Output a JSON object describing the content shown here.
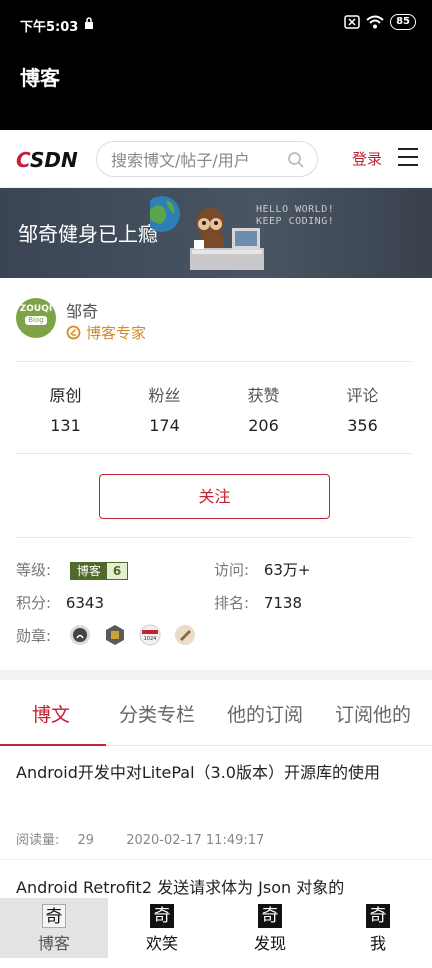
{
  "status_bar": {
    "time": "下午5:03",
    "battery": "85"
  },
  "app_bar": {
    "title": "博客"
  },
  "header": {
    "logo_c": "C",
    "logo_rest": "SDN",
    "search_placeholder": "搜索博文/帖子/用户",
    "login_label": "登录"
  },
  "banner": {
    "title": "邹奇健身已上瘾",
    "hello_line1": "HELLO WORLD!",
    "hello_line2": "KEEP CODING!"
  },
  "profile": {
    "avatar_text": "ZOUQI",
    "avatar_sub": "Blog",
    "username": "邹奇",
    "expert_label": "博客专家",
    "stats": [
      {
        "label": "原创",
        "value": "131"
      },
      {
        "label": "粉丝",
        "value": "174"
      },
      {
        "label": "获赞",
        "value": "206"
      },
      {
        "label": "评论",
        "value": "356"
      }
    ],
    "follow_label": "关注",
    "level_label": "等级:",
    "level_badge_text": "博客",
    "level_badge_num": "6",
    "visits_label": "访问:",
    "visits_value": "63万+",
    "points_label": "积分:",
    "points_value": "6343",
    "rank_label": "排名:",
    "rank_value": "7138",
    "medals_label": "勋章:",
    "medal_1024": "1024"
  },
  "tabs": [
    {
      "label": "博文",
      "active": true
    },
    {
      "label": "分类专栏",
      "active": false
    },
    {
      "label": "他的订阅",
      "active": false
    },
    {
      "label": "订阅他的",
      "active": false
    }
  ],
  "articles": [
    {
      "title": "Android开发中对LitePal（3.0版本）开源库的使用",
      "reads_label": "阅读量:",
      "reads": "29",
      "date": "2020-02-17 11:49:17"
    },
    {
      "title": "Android Retrofit2 发送请求体为 Json 对象的"
    }
  ],
  "bottom_nav": [
    {
      "icon": "奇",
      "label": "博客",
      "active": true
    },
    {
      "icon": "奇",
      "label": "欢笑",
      "active": false
    },
    {
      "icon": "奇",
      "label": "发现",
      "active": false
    },
    {
      "icon": "奇",
      "label": "我",
      "active": false
    }
  ],
  "colors": {
    "brand_red": "#c32136",
    "expert_orange": "#d68a26",
    "level_green": "#4f6a2a"
  }
}
